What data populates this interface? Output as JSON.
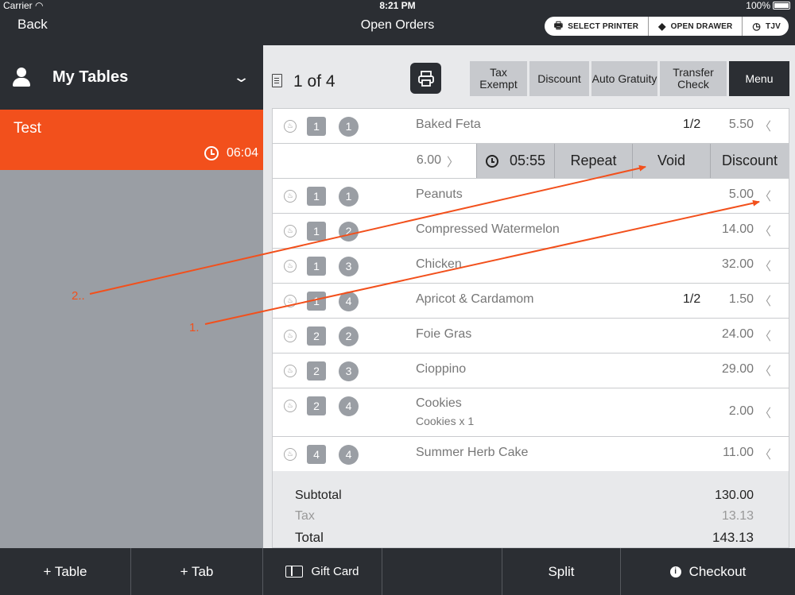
{
  "status": {
    "carrier": "Carrier",
    "time": "8:21 PM",
    "battery": "100%"
  },
  "nav": {
    "back": "Back",
    "title": "Open Orders"
  },
  "top_actions": {
    "select_printer": "SELECT PRINTER",
    "open_drawer": "OPEN DRAWER",
    "user": "TJV"
  },
  "sidebar": {
    "title": "My Tables",
    "tables": [
      {
        "name": "Test",
        "time": "06:04"
      }
    ]
  },
  "order": {
    "page": "1 of 4",
    "tabs": [
      {
        "label": "Tax Exempt"
      },
      {
        "label": "Discount"
      },
      {
        "label": "Auto Gratuity"
      },
      {
        "label": "Transfer Check"
      },
      {
        "label": "Menu"
      }
    ],
    "items": [
      {
        "seat": "1",
        "course": "1",
        "name": "Baked Feta",
        "fraction": "1/2",
        "price": "5.50"
      },
      {
        "seat": "1",
        "course": "1",
        "name": "Peanuts",
        "fraction": "",
        "price": "5.00"
      },
      {
        "seat": "1",
        "course": "2",
        "name": "Compressed Watermelon",
        "fraction": "",
        "price": "14.00"
      },
      {
        "seat": "1",
        "course": "3",
        "name": "Chicken",
        "fraction": "",
        "price": "32.00"
      },
      {
        "seat": "1",
        "course": "4",
        "name": "Apricot & Cardamom",
        "fraction": "1/2",
        "price": "1.50"
      },
      {
        "seat": "2",
        "course": "2",
        "name": "Foie Gras",
        "fraction": "",
        "price": "24.00"
      },
      {
        "seat": "2",
        "course": "3",
        "name": "Cioppino",
        "fraction": "",
        "price": "29.00"
      },
      {
        "seat": "2",
        "course": "4",
        "name": "Cookies",
        "modifier": "Cookies x 1",
        "fraction": "",
        "price": "2.00"
      },
      {
        "seat": "4",
        "course": "4",
        "name": "Summer Herb Cake",
        "fraction": "",
        "price": "11.00"
      }
    ],
    "item_action": {
      "price": "6.00",
      "timer": "05:55",
      "repeat": "Repeat",
      "void": "Void",
      "discount": "Discount"
    },
    "totals": {
      "subtotal_label": "Subtotal",
      "subtotal": "130.00",
      "tax_label": "Tax",
      "tax": "13.13",
      "total_label": "Total",
      "total": "143.13"
    }
  },
  "bottom": {
    "add_table": "+ Table",
    "add_tab": "+ Tab",
    "gift_card": "Gift Card",
    "split": "Split",
    "checkout": "Checkout"
  },
  "annotations": {
    "label_1": "1.",
    "label_2": "2..",
    "color": "#f2501c"
  },
  "colors": {
    "accent": "#f2501c",
    "dark": "#2b2e33"
  }
}
